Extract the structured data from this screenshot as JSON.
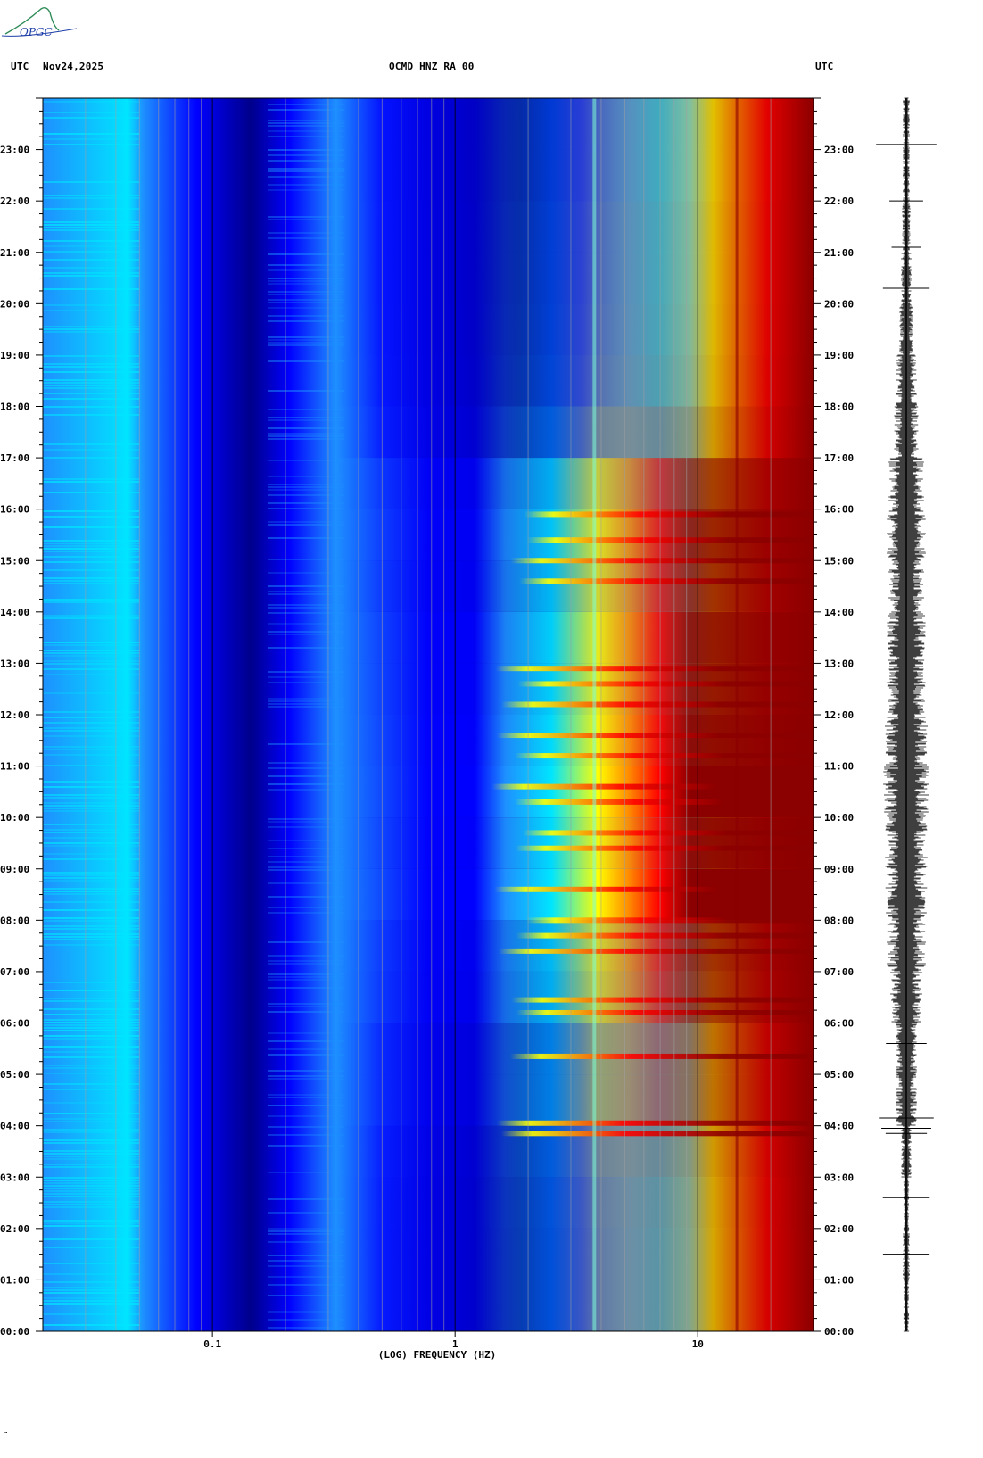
{
  "header": {
    "left_timezone": "UTC",
    "date": "Nov24,2025",
    "station": "OCMD HNZ RA 00",
    "right_timezone": "UTC"
  },
  "logo": {
    "text": "OPGC"
  },
  "chart_data": {
    "type": "heatmap",
    "title": "OCMD HNZ RA 00",
    "xlabel": "(LOG) FREQUENCY (HZ)",
    "x_scale": "log",
    "xlim": [
      0.02,
      30
    ],
    "x_ticks": [
      {
        "value": 0.1,
        "label": "0.1"
      },
      {
        "value": 1,
        "label": "1"
      },
      {
        "value": 10,
        "label": "10"
      }
    ],
    "ylim_hours": [
      0,
      24
    ],
    "y_ticks": [
      {
        "hour": 0,
        "label": "00:00"
      },
      {
        "hour": 1,
        "label": "01:00"
      },
      {
        "hour": 2,
        "label": "02:00"
      },
      {
        "hour": 3,
        "label": "03:00"
      },
      {
        "hour": 4,
        "label": "04:00"
      },
      {
        "hour": 5,
        "label": "05:00"
      },
      {
        "hour": 6,
        "label": "06:00"
      },
      {
        "hour": 7,
        "label": "07:00"
      },
      {
        "hour": 8,
        "label": "08:00"
      },
      {
        "hour": 9,
        "label": "09:00"
      },
      {
        "hour": 10,
        "label": "10:00"
      },
      {
        "hour": 11,
        "label": "11:00"
      },
      {
        "hour": 12,
        "label": "12:00"
      },
      {
        "hour": 13,
        "label": "13:00"
      },
      {
        "hour": 14,
        "label": "14:00"
      },
      {
        "hour": 15,
        "label": "15:00"
      },
      {
        "hour": 16,
        "label": "16:00"
      },
      {
        "hour": 17,
        "label": "17:00"
      },
      {
        "hour": 18,
        "label": "18:00"
      },
      {
        "hour": 19,
        "label": "19:00"
      },
      {
        "hour": 20,
        "label": "20:00"
      },
      {
        "hour": 21,
        "label": "21:00"
      },
      {
        "hour": 22,
        "label": "22:00"
      },
      {
        "hour": 23,
        "label": "23:00"
      }
    ],
    "colormap": [
      "#00008b",
      "#0000ff",
      "#1e90ff",
      "#00e5ff",
      "#7fffd4",
      "#ffff00",
      "#ff8c00",
      "#ff0000",
      "#8b0000"
    ],
    "activity_by_hour": [
      0.35,
      0.35,
      0.36,
      0.4,
      0.55,
      0.55,
      0.75,
      0.8,
      1.0,
      0.95,
      1.0,
      0.95,
      0.9,
      0.9,
      0.8,
      0.85,
      0.75,
      0.4,
      0.3,
      0.28,
      0.27,
      0.27,
      0.25,
      0.25
    ],
    "event_hours": [
      3.85,
      4.05,
      5.35,
      6.2,
      6.45,
      7.4,
      7.7,
      8.0,
      8.6,
      9.4,
      9.7,
      10.3,
      10.6,
      11.2,
      11.6,
      12.2,
      12.6,
      12.9,
      14.6,
      15.0,
      15.4,
      15.9
    ],
    "seismogram_amplitude_by_hour": [
      0.08,
      0.1,
      0.08,
      0.15,
      0.3,
      0.3,
      0.45,
      0.55,
      0.6,
      0.6,
      0.65,
      0.6,
      0.55,
      0.55,
      0.5,
      0.55,
      0.5,
      0.35,
      0.3,
      0.2,
      0.15,
      0.12,
      0.1,
      0.1
    ]
  }
}
